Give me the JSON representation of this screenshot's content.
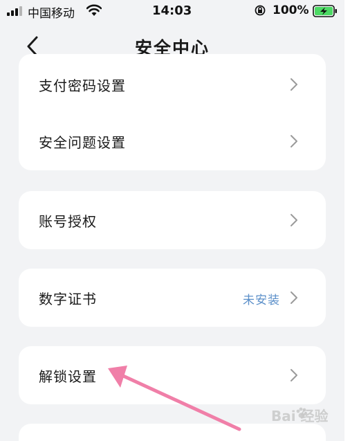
{
  "status_bar": {
    "carrier": "中国移动",
    "time": "14:03",
    "battery_percent": "100%",
    "battery_level": 1.0,
    "icons": [
      "signal-icon",
      "wifi-icon",
      "orientation-lock-icon",
      "battery-charging-icon"
    ]
  },
  "nav": {
    "title": "安全中心",
    "back_icon": "chevron-left-icon"
  },
  "groups": [
    {
      "rows": [
        {
          "label": "支付密码设置",
          "value": ""
        },
        {
          "label": "安全问题设置",
          "value": ""
        }
      ]
    },
    {
      "rows": [
        {
          "label": "账号授权",
          "value": ""
        }
      ]
    },
    {
      "rows": [
        {
          "label": "数字证书",
          "value": "未安装"
        }
      ]
    },
    {
      "rows": [
        {
          "label": "解锁设置",
          "value": ""
        }
      ]
    }
  ],
  "annotation": {
    "type": "arrow",
    "color": "#f07fa8",
    "target": "解锁设置"
  },
  "watermark": {
    "text": "Bai  经验"
  },
  "colors": {
    "background": "#f2f3f5",
    "card": "#ffffff",
    "value_text": "#5b8fc9",
    "chevron": "#9a9a9a",
    "battery_fill": "#4cd964"
  }
}
